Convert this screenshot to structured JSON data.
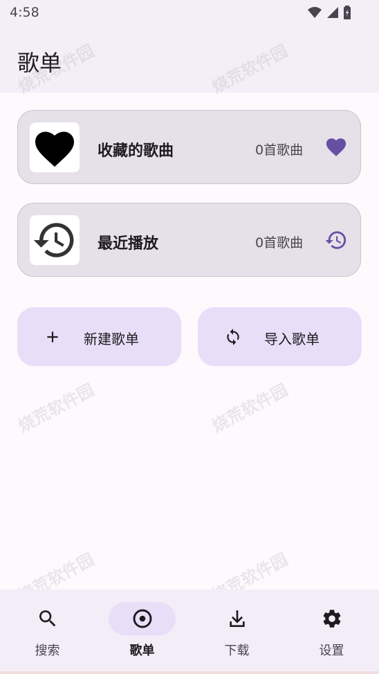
{
  "status_bar": {
    "time": "4:58",
    "icons": [
      "wifi-icon",
      "signal-icon",
      "battery-icon"
    ]
  },
  "app_bar": {
    "title": "歌单"
  },
  "cards": [
    {
      "title": "收藏的歌曲",
      "count": "0首歌曲",
      "thumb_icon": "heart-icon",
      "trailing_icon": "heart-icon"
    },
    {
      "title": "最近播放",
      "count": "0首歌曲",
      "thumb_icon": "history-icon",
      "trailing_icon": "history-icon"
    }
  ],
  "actions": [
    {
      "label": "新建歌单",
      "icon": "plus-icon"
    },
    {
      "label": "导入歌单",
      "icon": "sync-icon"
    }
  ],
  "watermark": "烧荒软件园",
  "bottom_nav": [
    {
      "label": "搜索",
      "icon": "search-icon",
      "active": false
    },
    {
      "label": "歌单",
      "icon": "disc-icon",
      "active": true
    },
    {
      "label": "下载",
      "icon": "download-icon",
      "active": false
    },
    {
      "label": "设置",
      "icon": "gear-icon",
      "active": false
    }
  ],
  "colors": {
    "accent": "#6750a4",
    "card_bg": "#e6e1e9",
    "button_bg": "#e8def8",
    "nav_bg": "#f3edf7"
  }
}
